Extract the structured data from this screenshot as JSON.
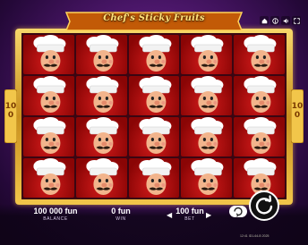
{
  "game": {
    "title": "Chef's Sticky Fruits",
    "side_left": "100",
    "side_right": "100"
  },
  "reels": {
    "columns": 5,
    "rows": 4,
    "symbol": "chef-symbol"
  },
  "bottom_bar": {
    "balance_value": "100 000 fun",
    "balance_label": "BALANCE",
    "win_value": "0 fun",
    "win_label": "WIN",
    "bet_value": "100 fun",
    "bet_label": "BET",
    "footer_note": "12:41  ID1-64-B 2025"
  },
  "icons": {
    "top_right": [
      "home-icon",
      "info-icon",
      "sound-icon",
      "fullscreen-icon"
    ],
    "spin": "spin-icon",
    "autoplay": "autoplay-icon",
    "bet_decrease": "chevron-left-icon",
    "bet_increase": "chevron-right-icon"
  },
  "colors": {
    "frame_gold": "#f2c64a",
    "background_purple": "#4a1668",
    "symbol_red": "#d31b1b"
  }
}
